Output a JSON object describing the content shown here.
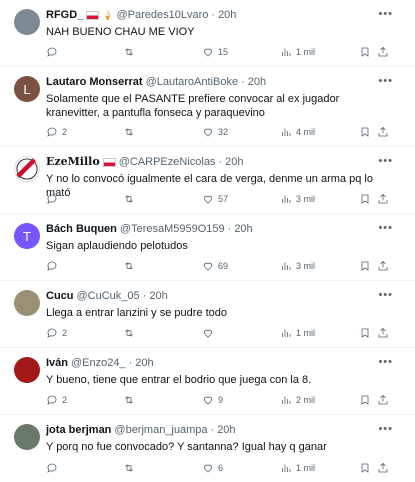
{
  "tweets": [
    {
      "name": "RFGD_",
      "handle": "@Paredes10Lvaro",
      "time": "20h",
      "text": "NAH BUENO CHAU ME VIOY",
      "replies": "",
      "likes": "15",
      "views": "1 mil",
      "avatar_color": "#7d8a96",
      "avatar_letter": ""
    },
    {
      "name": "Lautaro Monserrat",
      "handle": "@LautaroAntiBoke",
      "time": "20h",
      "text": "Solamente que el PASANTE prefiere convocar al ex jugador kranevitter, a pantufla fonseca y paraquevino",
      "replies": "2",
      "likes": "32",
      "views": "4 mil",
      "avatar_color": "#7b5140",
      "avatar_letter": "L"
    },
    {
      "name": "EzeMillo",
      "handle": "@CARPEzeNicolas",
      "time": "20h",
      "text": "Y no lo convocó igualmente el cara de verga, denme un arma pq lo mató",
      "replies": "",
      "likes": "57",
      "views": "3 mil",
      "avatar_color": "#c8102e",
      "avatar_letter": ""
    },
    {
      "name": "Bách Buquen",
      "handle": "@TeresaM5959O159",
      "time": "20h",
      "text": "Sigan aplaudiendo pelotudos",
      "replies": "",
      "likes": "69",
      "views": "3 mil",
      "avatar_color": "#7856ff",
      "avatar_letter": "T"
    },
    {
      "name": "Cucu",
      "handle": "@CuCuk_05",
      "time": "20h",
      "text": "Llega a entrar lanzini y se pudre todo",
      "replies": "2",
      "likes": "",
      "views": "1 mil",
      "avatar_color": "#9a8f70",
      "avatar_letter": ""
    },
    {
      "name": "Iván",
      "handle": "@Enzo24_",
      "time": "20h",
      "text": "Y bueno, tiene que entrar el bodrio que juega con la 8.",
      "replies": "2",
      "likes": "9",
      "views": "2 mil",
      "avatar_color": "#a01818",
      "avatar_letter": ""
    },
    {
      "name": "jota berjman",
      "handle": "@berjman_juampa",
      "time": "20h",
      "text": "Y porq no fue convocado? Y santanna? Igual hay q ganar",
      "replies": "",
      "likes": "6",
      "views": "1 mil",
      "avatar_color": "#6a7a6a",
      "avatar_letter": ""
    }
  ],
  "icons": {
    "reply": "reply-icon",
    "retweet": "retweet-icon",
    "like": "heart-icon",
    "views": "views-icon",
    "bookmark": "bookmark-icon",
    "share": "share-icon",
    "more": "more-icon"
  }
}
